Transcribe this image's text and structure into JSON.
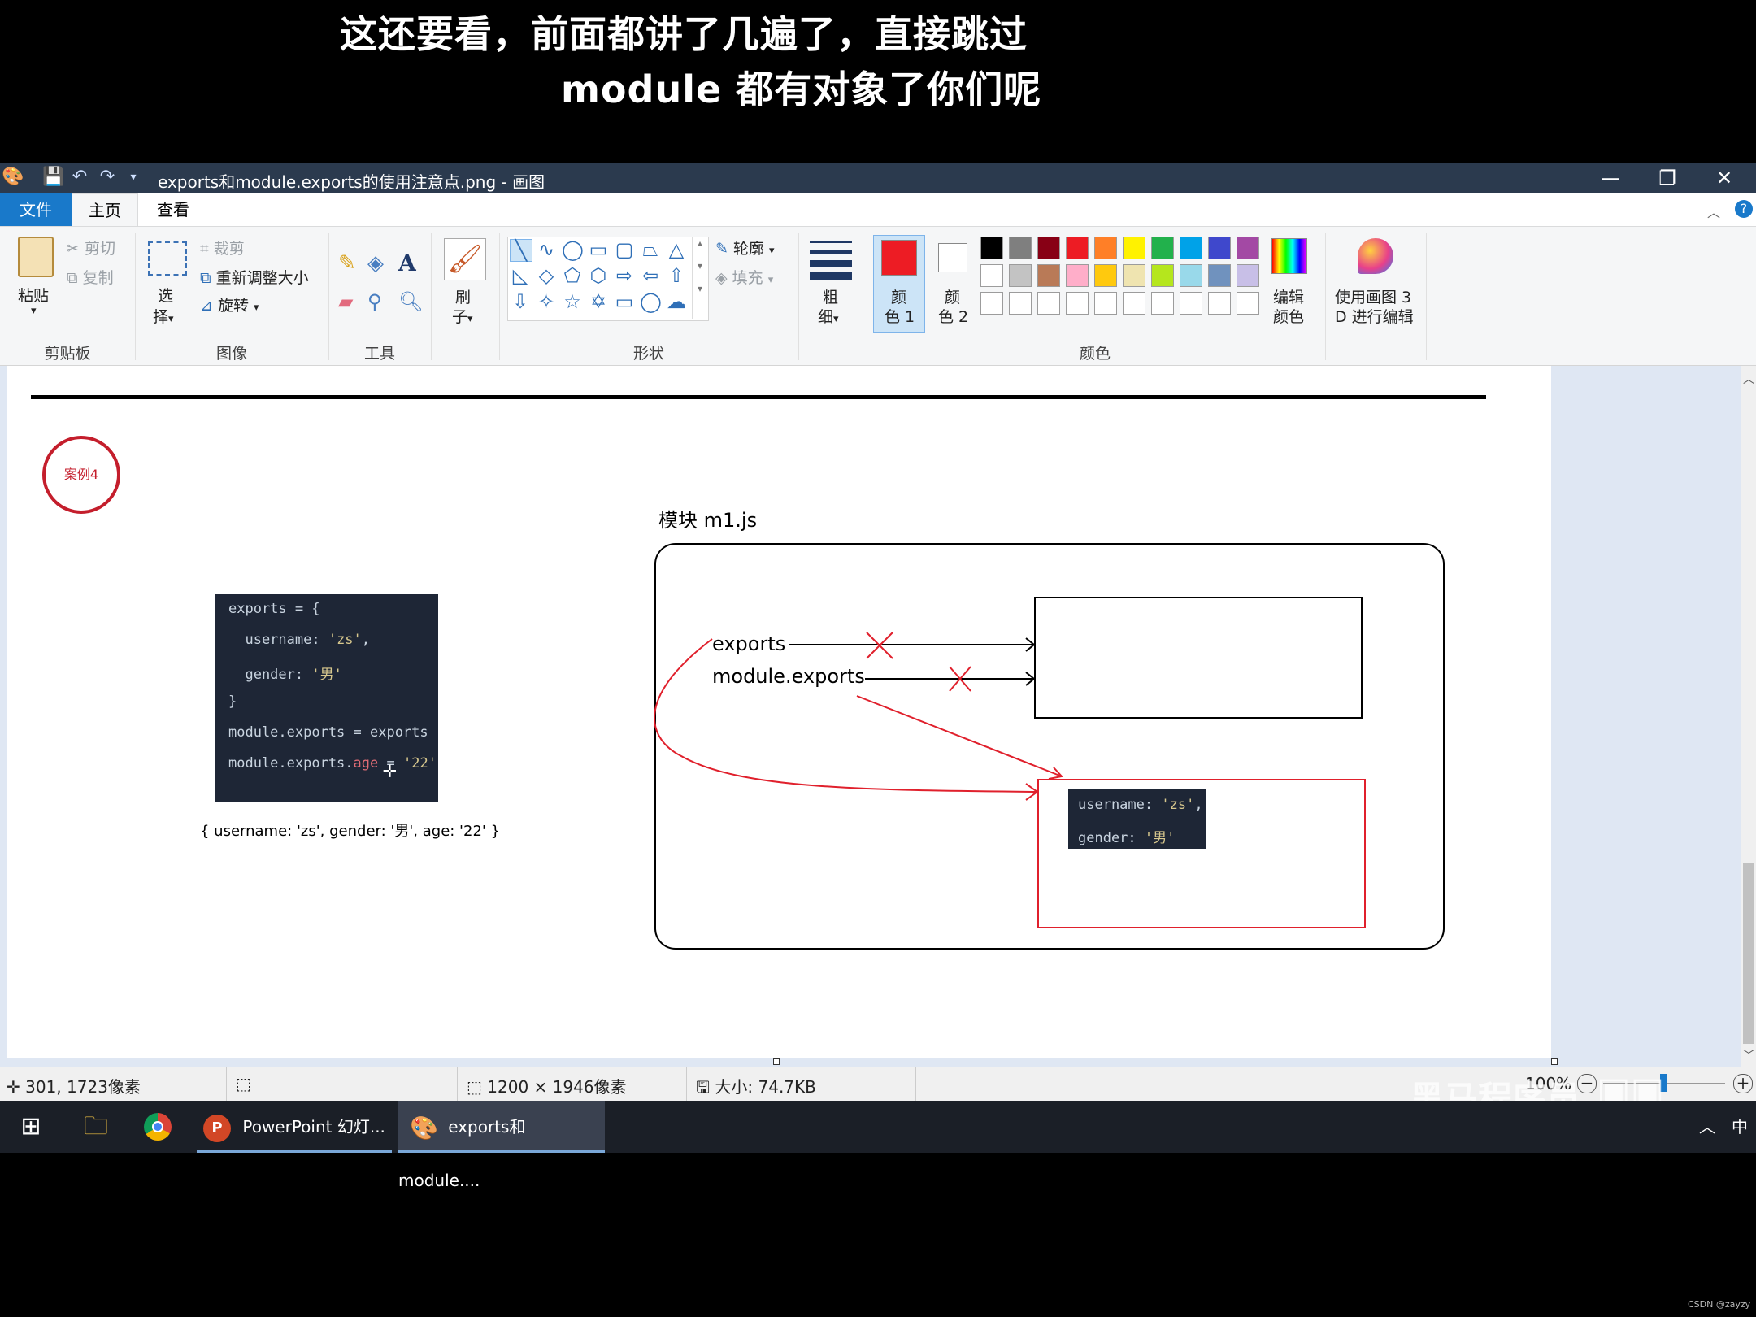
{
  "subtitles": {
    "line1": "这还要看，前面都讲了几遍了，直接跳过",
    "line2": "module 都有对象了你们呢"
  },
  "window": {
    "title": "exports和module.exports的使用注意点.png - 画图",
    "minimize": "—",
    "restore": "❐",
    "close": "✕"
  },
  "tabs": {
    "file": "文件",
    "home": "主页",
    "view": "查看"
  },
  "ribbon": {
    "clipboard": {
      "paste": "粘贴",
      "cut": "剪切",
      "copy": "复制",
      "label": "剪贴板"
    },
    "image": {
      "select_1": "选",
      "select_2": "择",
      "crop": "裁剪",
      "resize": "重新调整大小",
      "rotate": "旋转",
      "label": "图像"
    },
    "tools": {
      "label": "工具"
    },
    "brush": {
      "line1": "刷",
      "line2": "子"
    },
    "shapes": {
      "outline": "轮廓",
      "fill": "填充",
      "label": "形状"
    },
    "size": {
      "line1": "粗",
      "line2": "细"
    },
    "color1": {
      "line1": "颜",
      "line2": "色 1",
      "value": "#ed1c24"
    },
    "color2": {
      "line1": "颜",
      "line2": "色 2",
      "value": "#ffffff"
    },
    "edit_colors": {
      "line1": "编辑",
      "line2": "颜色"
    },
    "paint3d": {
      "line1": "使用画图 3",
      "line2": "D 进行编辑"
    },
    "colors_label": "颜色",
    "palette_row1": [
      "#000000",
      "#7f7f7f",
      "#880015",
      "#ed1c24",
      "#ff7f27",
      "#fff200",
      "#22b14c",
      "#00a2e8",
      "#3f48cc",
      "#a349a4"
    ],
    "palette_row2": [
      "#ffffff",
      "#c3c3c3",
      "#b97a57",
      "#ffaec9",
      "#ffc90e",
      "#efe4b0",
      "#b5e61d",
      "#99d9ea",
      "#7092be",
      "#c8bfe7"
    ]
  },
  "drawing": {
    "badge": "案例4",
    "module_title": "模块 m1.js",
    "code_lines": [
      "exports = {",
      "  username: ",
      "'zs'",
      ",",
      "  gender: ",
      "'男'",
      "}",
      "module.exports = exports",
      "module.exports.",
      "age",
      " = ",
      "'22'"
    ],
    "result": "{ username: 'zs', gender: '男', age: '22' }",
    "exports_label": "exports",
    "module_exports_label": "module.exports",
    "obj_line1_key": "username: ",
    "obj_line1_val": "'zs'",
    "obj_line1_end": ",",
    "obj_line2_key": "gender: ",
    "obj_line2_val": "'男'"
  },
  "status": {
    "cursor_pos": "301, 1723像素",
    "image_size": "1200 × 1946像素",
    "file_size": "大小: 74.7KB",
    "zoom": "100%"
  },
  "watermark": {
    "text": "黑马程序员",
    "csdn": "CSDN @zayzy"
  },
  "taskbar": {
    "ppt": "PowerPoint 幻灯...",
    "paint": "exports和module....",
    "ime": "中"
  }
}
